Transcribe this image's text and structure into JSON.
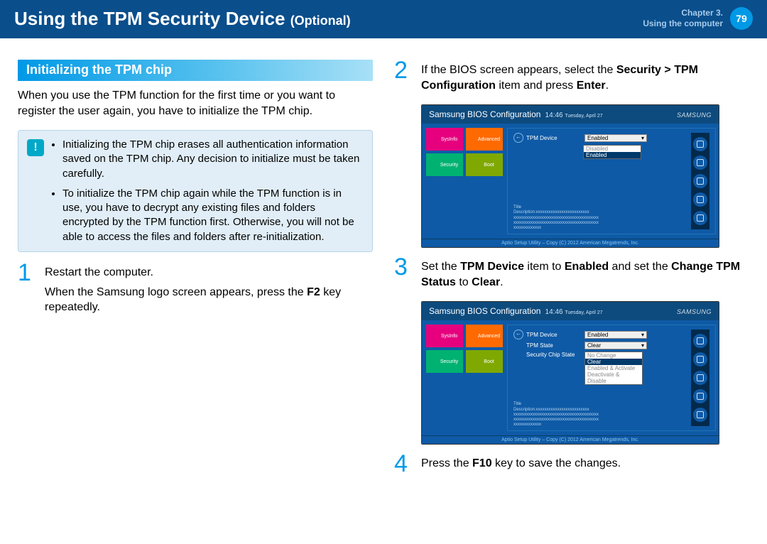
{
  "header": {
    "title": "Using the TPM Security Device",
    "subtitle": "(Optional)",
    "chapter_line1": "Chapter 3.",
    "chapter_line2": "Using the computer",
    "page_number": "79"
  },
  "section_heading": "Initializing the TPM chip",
  "intro_text": "When you use the TPM function for the first time or you want to register the user again, you have to initialize the TPM chip.",
  "info_bullets": [
    "Initializing the TPM chip erases all authentication information saved on the TPM chip. Any decision to initialize must be taken carefully.",
    "To initialize the TPM chip again while the TPM function is in use, you have to decrypt any existing files and folders encrypted by the TPM function first. Otherwise, you will not be able to access the files and folders after re-initialization."
  ],
  "steps": {
    "one_num": "1",
    "one_a": "Restart the computer.",
    "one_b_pre": "When the Samsung logo screen appears, press the ",
    "one_b_key": "F2",
    "one_b_post": " key repeatedly.",
    "two_num": "2",
    "two_pre": "If the BIOS screen appears, select the ",
    "two_path": "Security > TPM Configuration",
    "two_mid": " item and press ",
    "two_key": "Enter",
    "two_post": ".",
    "three_num": "3",
    "three_pre": "Set the ",
    "three_item1": "TPM Device",
    "three_mid1": " item to ",
    "three_val1": "Enabled",
    "three_mid2": " and set the ",
    "three_item2": "Change TPM Status",
    "three_mid3": " to ",
    "three_val2": "Clear",
    "three_post": ".",
    "four_num": "4",
    "four_pre": "Press the ",
    "four_key": "F10",
    "four_post": " key to save the changes."
  },
  "bios": {
    "title": "Samsung BIOS Configuration",
    "time": "14:46",
    "date": "Tuesday, April 27",
    "logo": "SAMSUNG",
    "tiles": {
      "sysinfo": "SysInfo",
      "advanced": "Advanced",
      "security": "Security",
      "boot": "Boot"
    },
    "field_tpm_device": "TPM Device",
    "field_tpm_state": "TPM State",
    "field_sec_chip": "Security Chip State",
    "value_enabled": "Enabled",
    "value_disabled": "Disabled",
    "value_clear": "Clear",
    "value_nochange": "No Change",
    "value_enable_activate": "Enabled & Activate",
    "value_deactivate_disable": "Deactivate & Disable",
    "desc_label": "Title",
    "desc_line": "Description:xxxxxxxxxxxxxxxxxxxxxxxxx",
    "footer": "Aptio Setup Utility – Copy (C) 2012 American Megatrends, Inc."
  }
}
